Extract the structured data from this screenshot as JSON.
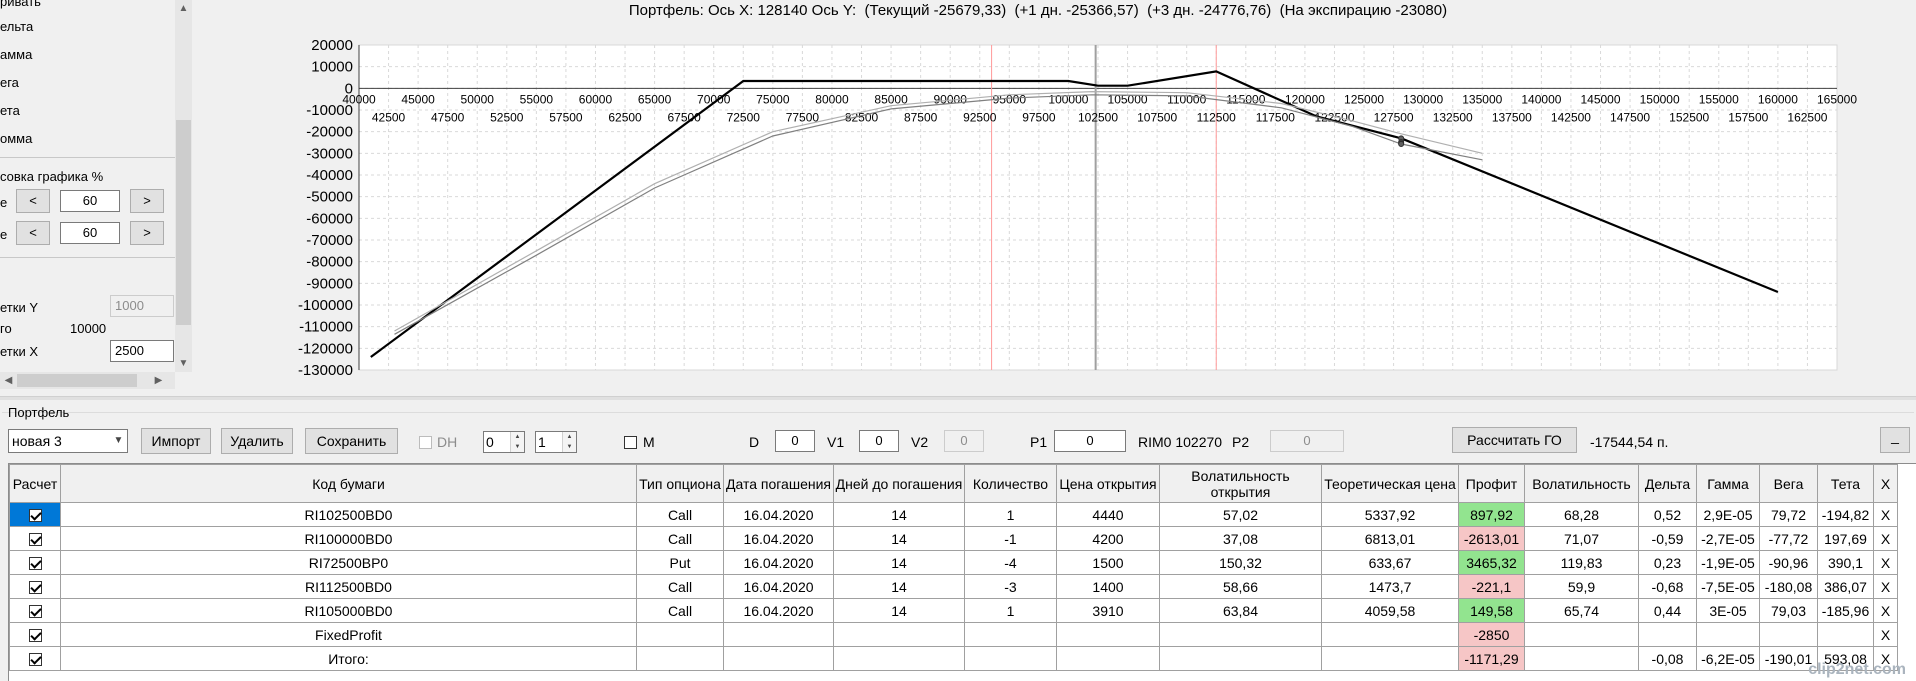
{
  "left_panel": {
    "items": [
      "ривать",
      "ельта",
      "амма",
      "ега",
      "ета",
      "омма"
    ],
    "scale_title": "совка графика %",
    "row1": {
      "label": "е",
      "dec": "<",
      "value": "60",
      "inc": ">"
    },
    "row2": {
      "label": "е",
      "dec": "<",
      "value": "60",
      "inc": ">"
    },
    "grid_y_label": "етки Y",
    "grid_y_value": "1000",
    "go_label": "го",
    "go_value": "10000",
    "grid_x_label": "етки X",
    "grid_x_value": "2500"
  },
  "chart": {
    "title": "Портфель: Ось X: 128140 Ось Y:  (Текущий -25679,33)  (+1 дн. -25366,57)  (+3 дн. -24776,76)  (На экспирацию -23080)"
  },
  "chart_data": {
    "type": "line",
    "xlim": [
      40000,
      165000
    ],
    "ylim": [
      -130000,
      20000
    ],
    "x_ticks_major": [
      "40000",
      "45000",
      "50000",
      "55000",
      "60000",
      "65000",
      "70000",
      "75000",
      "80000",
      "85000",
      "90000",
      "95000",
      "100000",
      "105000",
      "110000",
      "115000",
      "120000",
      "125000",
      "130000",
      "135000",
      "140000",
      "145000",
      "150000",
      "155000",
      "160000",
      "165000"
    ],
    "x_ticks_minor": [
      "42500",
      "47500",
      "52500",
      "57500",
      "62500",
      "67500",
      "72500",
      "77500",
      "82500",
      "87500",
      "92500",
      "97500",
      "102500",
      "107500",
      "112500",
      "117500",
      "122500",
      "127500",
      "132500",
      "137500",
      "142500",
      "147500",
      "152500",
      "157500",
      "162500"
    ],
    "y_ticks": [
      "20000",
      "10000",
      "0",
      "-10000",
      "-20000",
      "-30000",
      "-40000",
      "-50000",
      "-60000",
      "-70000",
      "-80000",
      "-90000",
      "-100000",
      "-110000",
      "-120000",
      "-130000"
    ],
    "vlines": [
      {
        "x": 93500,
        "color": "#ff9a9a"
      },
      {
        "x": 102300,
        "color": "#a0a0a0"
      },
      {
        "x": 112500,
        "color": "#ff9a9a"
      }
    ],
    "series": [
      {
        "color": "#000000",
        "width": 2.2,
        "points": [
          [
            41000,
            -124000
          ],
          [
            72500,
            3400
          ],
          [
            100000,
            3400
          ],
          [
            102500,
            1200
          ],
          [
            105000,
            1200
          ],
          [
            112500,
            7800
          ],
          [
            121000,
            -13000
          ],
          [
            128140,
            -23080
          ],
          [
            160000,
            -94000
          ]
        ]
      },
      {
        "color": "#b0b0b0",
        "width": 1.2,
        "points": [
          [
            43000,
            -112000
          ],
          [
            55000,
            -75000
          ],
          [
            65000,
            -44000
          ],
          [
            75000,
            -20000
          ],
          [
            85000,
            -8000
          ],
          [
            95000,
            -3000
          ],
          [
            102000,
            -1500
          ],
          [
            110000,
            -2000
          ],
          [
            118000,
            -7000
          ],
          [
            124000,
            -15000
          ],
          [
            128140,
            -21000
          ],
          [
            135000,
            -30000
          ]
        ]
      },
      {
        "color": "#808080",
        "width": 1.2,
        "points": [
          [
            43000,
            -113500
          ],
          [
            55000,
            -77000
          ],
          [
            65000,
            -46000
          ],
          [
            75000,
            -22000
          ],
          [
            85000,
            -9500
          ],
          [
            95000,
            -4500
          ],
          [
            102000,
            -3000
          ],
          [
            110000,
            -3500
          ],
          [
            118000,
            -9000
          ],
          [
            124000,
            -17500
          ],
          [
            128140,
            -25679.33
          ],
          [
            135000,
            -33000
          ]
        ]
      }
    ],
    "markers": [
      [
        128140,
        -23080
      ],
      [
        128140,
        -24776.76
      ],
      [
        128140,
        -25366.57
      ],
      [
        128140,
        -25679.33
      ]
    ]
  },
  "portfolio": {
    "group_label": "Портфель",
    "combo_value": "новая 3",
    "import_label": "Импорт",
    "delete_label": "Удалить",
    "save_label": "Сохранить",
    "dh_label": "DH",
    "spin1": "0",
    "spin2": "1",
    "m_label": "M",
    "d_label": "D",
    "d_value": "0",
    "v1_label": "V1",
    "v1_value": "0",
    "v2_label": "V2",
    "v2_value": "0",
    "p1_label": "P1",
    "p1_value": "0",
    "rim_label": "RIM0 102270",
    "p2_label": "P2",
    "p2_value": "0",
    "calc_go_label": "Рассчитать ГО",
    "go_result": "-17544,54 п.",
    "minimize_label": "_"
  },
  "table": {
    "headers": [
      "Расчет",
      "Код бумаги",
      "Тип опциона",
      "Дата погашения",
      "Дней до погашения",
      "Количество",
      "Цена открытия",
      "Волатильность открытия",
      "Теоретическая цена",
      "Профит",
      "Волатильность",
      "Дельта",
      "Гамма",
      "Вега",
      "Тета",
      "X"
    ],
    "rows": [
      {
        "checked": true,
        "selected": true,
        "code": "RI102500BD0",
        "type": "Call",
        "date": "16.04.2020",
        "days": "14",
        "qty": "1",
        "open": "4440",
        "vol_open": "57,02",
        "theo": "5337,92",
        "profit": "897,92",
        "profit_sign": "pos",
        "vol": "68,28",
        "delta": "0,52",
        "gamma": "2,9E-05",
        "vega": "79,72",
        "theta": "-194,82",
        "x": "X"
      },
      {
        "checked": true,
        "selected": false,
        "code": "RI100000BD0",
        "type": "Call",
        "date": "16.04.2020",
        "days": "14",
        "qty": "-1",
        "open": "4200",
        "vol_open": "37,08",
        "theo": "6813,01",
        "profit": "-2613,01",
        "profit_sign": "neg",
        "vol": "71,07",
        "delta": "-0,59",
        "gamma": "-2,7E-05",
        "vega": "-77,72",
        "theta": "197,69",
        "x": "X"
      },
      {
        "checked": true,
        "selected": false,
        "code": "RI72500BP0",
        "type": "Put",
        "date": "16.04.2020",
        "days": "14",
        "qty": "-4",
        "open": "1500",
        "vol_open": "150,32",
        "theo": "633,67",
        "profit": "3465,32",
        "profit_sign": "pos",
        "vol": "119,83",
        "delta": "0,23",
        "gamma": "-1,9E-05",
        "vega": "-90,96",
        "theta": "390,1",
        "x": "X"
      },
      {
        "checked": true,
        "selected": false,
        "code": "RI112500BD0",
        "type": "Call",
        "date": "16.04.2020",
        "days": "14",
        "qty": "-3",
        "open": "1400",
        "vol_open": "58,66",
        "theo": "1473,7",
        "profit": "-221,1",
        "profit_sign": "neg",
        "vol": "59,9",
        "delta": "-0,68",
        "gamma": "-7,5E-05",
        "vega": "-180,08",
        "theta": "386,07",
        "x": "X"
      },
      {
        "checked": true,
        "selected": false,
        "code": "RI105000BD0",
        "type": "Call",
        "date": "16.04.2020",
        "days": "14",
        "qty": "1",
        "open": "3910",
        "vol_open": "63,84",
        "theo": "4059,58",
        "profit": "149,58",
        "profit_sign": "pos",
        "vol": "65,74",
        "delta": "0,44",
        "gamma": "3E-05",
        "vega": "79,03",
        "theta": "-185,96",
        "x": "X"
      },
      {
        "checked": true,
        "selected": false,
        "code": "FixedProfit",
        "type": "",
        "date": "",
        "days": "",
        "qty": "",
        "open": "",
        "vol_open": "",
        "theo": "",
        "profit": "-2850",
        "profit_sign": "neg",
        "vol": "",
        "delta": "",
        "gamma": "",
        "vega": "",
        "theta": "",
        "x": "X"
      },
      {
        "checked": true,
        "selected": false,
        "code": "Итого:",
        "type": "",
        "date": "",
        "days": "",
        "qty": "",
        "open": "",
        "vol_open": "",
        "theo": "",
        "profit": "-1171,29",
        "profit_sign": "neg",
        "vol": "",
        "delta": "-0,08",
        "gamma": "-6,2E-05",
        "vega": "-190,01",
        "theta": "593,08",
        "x": "X"
      }
    ]
  },
  "watermark": "clip2net.com"
}
